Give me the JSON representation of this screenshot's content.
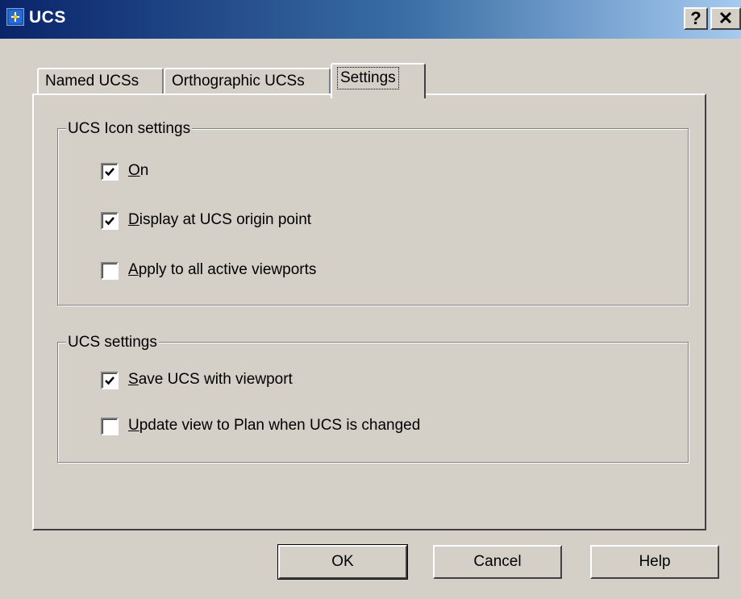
{
  "window": {
    "title": "UCS",
    "help_glyph": "?",
    "close_glyph": "✕",
    "icon": "ucs-app-icon"
  },
  "tabs": [
    {
      "label": "Named UCSs",
      "selected": false
    },
    {
      "label": "Orthographic UCSs",
      "selected": false
    },
    {
      "label": "Settings",
      "selected": true
    }
  ],
  "icon_settings": {
    "legend": "UCS Icon settings",
    "options": [
      {
        "label_mnemonic": "O",
        "label_rest": "n",
        "checked": true
      },
      {
        "label_mnemonic": "D",
        "label_rest": "isplay at UCS origin point",
        "checked": true
      },
      {
        "label_mnemonic": "A",
        "label_rest": "pply to all active viewports",
        "checked": false
      }
    ]
  },
  "ucs_settings": {
    "legend": "UCS settings",
    "options": [
      {
        "label_mnemonic": "S",
        "label_rest": "ave UCS with viewport",
        "checked": true
      },
      {
        "label_mnemonic": "U",
        "label_rest": "pdate view to Plan when UCS is changed",
        "checked": false
      }
    ]
  },
  "buttons": {
    "ok": "OK",
    "cancel": "Cancel",
    "help": "Help"
  },
  "colors": {
    "face": "#d4d0c8",
    "title_start": "#0a246a",
    "title_end": "#a6caf0"
  }
}
